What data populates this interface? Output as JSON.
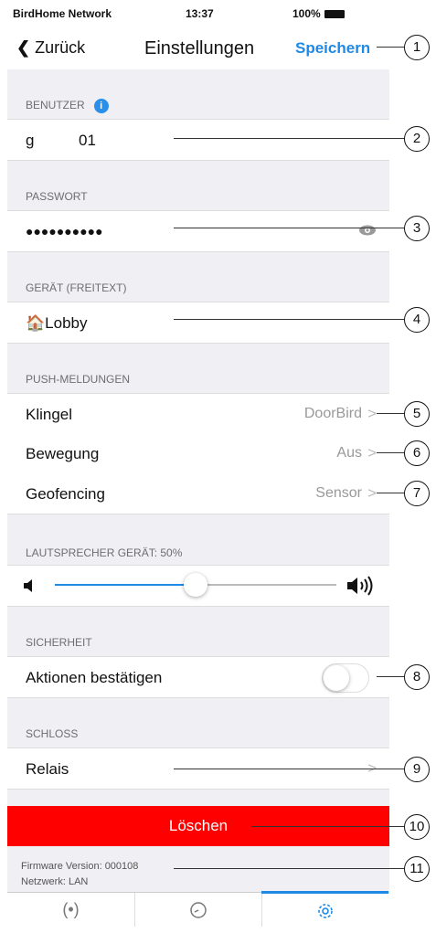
{
  "status": {
    "carrier": "BirdHome Network",
    "time": "13:37",
    "battery": "100%"
  },
  "nav": {
    "back": "Zurück",
    "title": "Einstellungen",
    "save": "Speichern"
  },
  "sections": {
    "user": "BENUTZER",
    "password": "PASSWORT",
    "device": "GERÄT (FREITEXT)",
    "push": "PUSH-MELDUNGEN",
    "speaker": "LAUTSPRECHER GERÄT: 50%",
    "security": "SICHERHEIT",
    "lock": "SCHLOSS"
  },
  "fields": {
    "user_prefix": "g",
    "user_suffix": "01",
    "password_mask": "●●●●●●●●●●",
    "device_name": "🏠Lobby"
  },
  "push_rows": [
    {
      "label": "Klingel",
      "value": "DoorBird"
    },
    {
      "label": "Bewegung",
      "value": "Aus"
    },
    {
      "label": "Geofencing",
      "value": "Sensor"
    }
  ],
  "speaker_level": 0.5,
  "security_row": {
    "label": "Aktionen bestätigen",
    "toggle_on": false
  },
  "lock_row": {
    "label": "Relais"
  },
  "delete_label": "Löschen",
  "footer": {
    "firmware": "Firmware Version: 000108",
    "network": "Netzwerk: LAN"
  },
  "callouts": [
    "1",
    "2",
    "3",
    "4",
    "5",
    "6",
    "7",
    "8",
    "9",
    "10",
    "11"
  ],
  "colors": {
    "accent": "#1e8ae6",
    "delete": "#ff0000"
  }
}
